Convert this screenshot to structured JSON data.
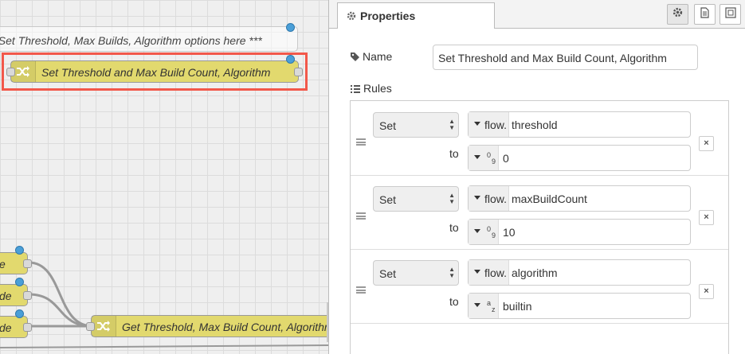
{
  "canvas": {
    "comment_text": "** Set Threshold, Max Builds, Algorithm options here ***",
    "selected_node_label": "Set Threshold and Max Build Count, Algorithm",
    "left_node_1_label": "e",
    "left_node_2_label": "de",
    "left_node_3_label": "de",
    "bottom_node_label": "Get Threshold, Max Build Count, Algorithm"
  },
  "panel": {
    "tab_title": "Properties",
    "name_label": "Name",
    "name_value": "Set Threshold and Max Build Count, Algorithm",
    "rules_label": "Rules",
    "rules": [
      {
        "action": "Set",
        "target_type": "flow.",
        "target": "threshold",
        "to_label": "to",
        "value_type": "number",
        "value": "0"
      },
      {
        "action": "Set",
        "target_type": "flow.",
        "target": "maxBuildCount",
        "to_label": "to",
        "value_type": "number",
        "value": "10"
      },
      {
        "action": "Set",
        "target_type": "flow.",
        "target": "algorithm",
        "to_label": "to",
        "value_type": "string",
        "value": "builtin"
      }
    ],
    "remove_glyph": "×"
  },
  "colors": {
    "node_fill": "#e2d96e",
    "selection": "#f2584a",
    "status_dot": "#4a9fd8"
  },
  "icons": [
    "shuffle-icon",
    "gear-icon",
    "document-icon",
    "frame-icon",
    "tag-icon",
    "list-icon",
    "number-type-icon",
    "string-type-icon",
    "drag-handle-icon",
    "remove-icon"
  ]
}
